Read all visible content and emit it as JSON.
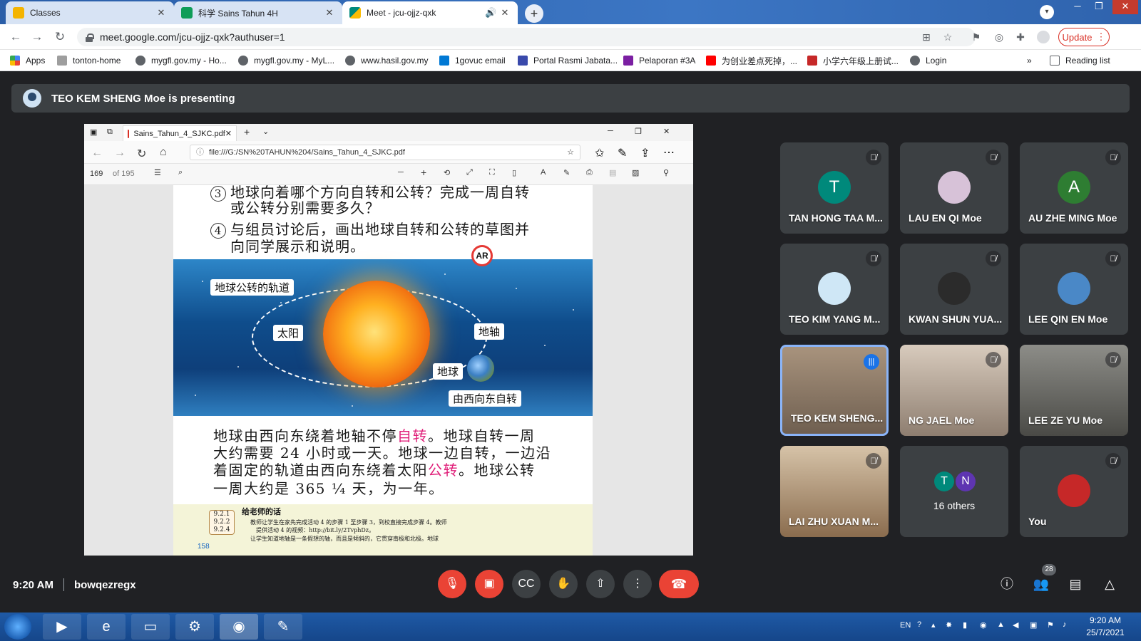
{
  "browser": {
    "tabs": [
      {
        "title": "Classes",
        "color": "#f4b400"
      },
      {
        "title": "科学 Sains Tahun 4H",
        "color": "#0f9d58"
      },
      {
        "title": "Meet - jcu-ojjz-qxk",
        "color": "#00897b"
      }
    ],
    "url": "meet.google.com/jcu-ojjz-qxk?authuser=1",
    "update_label": "Update",
    "bookmarks": [
      {
        "label": "Apps",
        "color": "#4285f4"
      },
      {
        "label": "tonton-home",
        "color": "#9e9e9e"
      },
      {
        "label": "mygfl.gov.my - Ho...",
        "color": "#5f6368"
      },
      {
        "label": "mygfl.gov.my - MyL...",
        "color": "#5f6368"
      },
      {
        "label": "www.hasil.gov.my",
        "color": "#5f6368"
      },
      {
        "label": "1govuc email",
        "color": "#0078d4"
      },
      {
        "label": "Portal Rasmi Jabata...",
        "color": "#3949ab"
      },
      {
        "label": "Pelaporan #3A",
        "color": "#7b1fa2"
      },
      {
        "label": "为创业差点死掉，...",
        "color": "#ff0000"
      },
      {
        "label": "小学六年级上册试...",
        "color": "#c62828"
      },
      {
        "label": "Login",
        "color": "#5f6368"
      }
    ],
    "reading_list": "Reading list"
  },
  "meet": {
    "presenting_text": "TEO KEM SHENG Moe is presenting",
    "meeting_time": "9:20 AM",
    "meeting_code": "bowqezregx",
    "participant_count": "28",
    "tiles": [
      {
        "name": "TAN HONG TAA M...",
        "initial": "T",
        "color": "#00897b"
      },
      {
        "name": "LAU EN QI Moe",
        "initial": "",
        "color": "#d7c2d8"
      },
      {
        "name": "AU ZHE MING Moe",
        "initial": "A",
        "color": "#2e7d32"
      },
      {
        "name": "TEO KIM YANG M...",
        "initial": "",
        "color": "#cfe7f6"
      },
      {
        "name": "KWAN SHUN YUA...",
        "initial": "",
        "color": "#2b2b2b"
      },
      {
        "name": "LEE QIN EN Moe",
        "initial": "",
        "color": "#4a88c7"
      },
      {
        "name": "TEO KEM SHENG...",
        "initial": "",
        "color": "#8a7a6a"
      },
      {
        "name": "NG JAEL Moe",
        "initial": "",
        "color": "#c9b8a6"
      },
      {
        "name": "LEE ZE YU Moe",
        "initial": "",
        "color": "#6a6a66"
      },
      {
        "name": "LAI ZHU XUAN M...",
        "initial": "",
        "color": "#b89a7a"
      },
      {
        "name": "16 others",
        "initial": "",
        "color": ""
      },
      {
        "name": "You",
        "initial": "",
        "color": "#c62828"
      }
    ],
    "others_initials": [
      "T",
      "N"
    ]
  },
  "shared": {
    "tab_title": "Sains_Tahun_4_SJKC.pdf",
    "file_url": "file:///G:/SN%20TAHUN%204/Sains_Tahun_4_SJKC.pdf",
    "page_current": "169",
    "page_total": "of 195",
    "pdf": {
      "q3_cont": "地球向着哪个方向自转和公转？完成一周自转",
      "q3_line2": "或公转分别需要多久？",
      "q4_num": "4",
      "q4_line1": "与组员讨论后，画出地球自转和公转的草图并",
      "q4_line2": "向同学展示和说明。",
      "labels": {
        "orbit": "地球公转的轨道",
        "sun": "太阳",
        "axis": "地轴",
        "earth": "地球",
        "west_east": "由西向东自转",
        "ar": "AR"
      },
      "body": [
        [
          "地球由西向东绕着地轴不停",
          "自转",
          "。地球自转一周"
        ],
        [
          "大约需要 24 小时或一天。地球一边自转，一边沿",
          "",
          ""
        ],
        [
          "着固定的轨道由西向东绕着太阳",
          "公转",
          "。地球公转"
        ],
        [
          "一周大约是 365 ¼ 天，为一年。",
          "",
          ""
        ]
      ],
      "teacher_title": "给老师的话",
      "teacher_codes": [
        "9.2.1",
        "9.2.2",
        "9.2.4"
      ],
      "teacher_text1": "教师让学生在家先完成活动 4 的步骤 1 至步骤 3，到校直接完成步骤 4。教师",
      "teacher_text2": "提供活动 4 的视频：http://bit.ly/2TvphDz。",
      "teacher_text3": "让学生知道地轴是一条假想的轴，而且是倾斜的，它贯穿南极和北极。地球",
      "page_no": "158"
    }
  },
  "taskbar": {
    "lang": "EN",
    "time": "9:20 AM",
    "date": "25/7/2021"
  }
}
